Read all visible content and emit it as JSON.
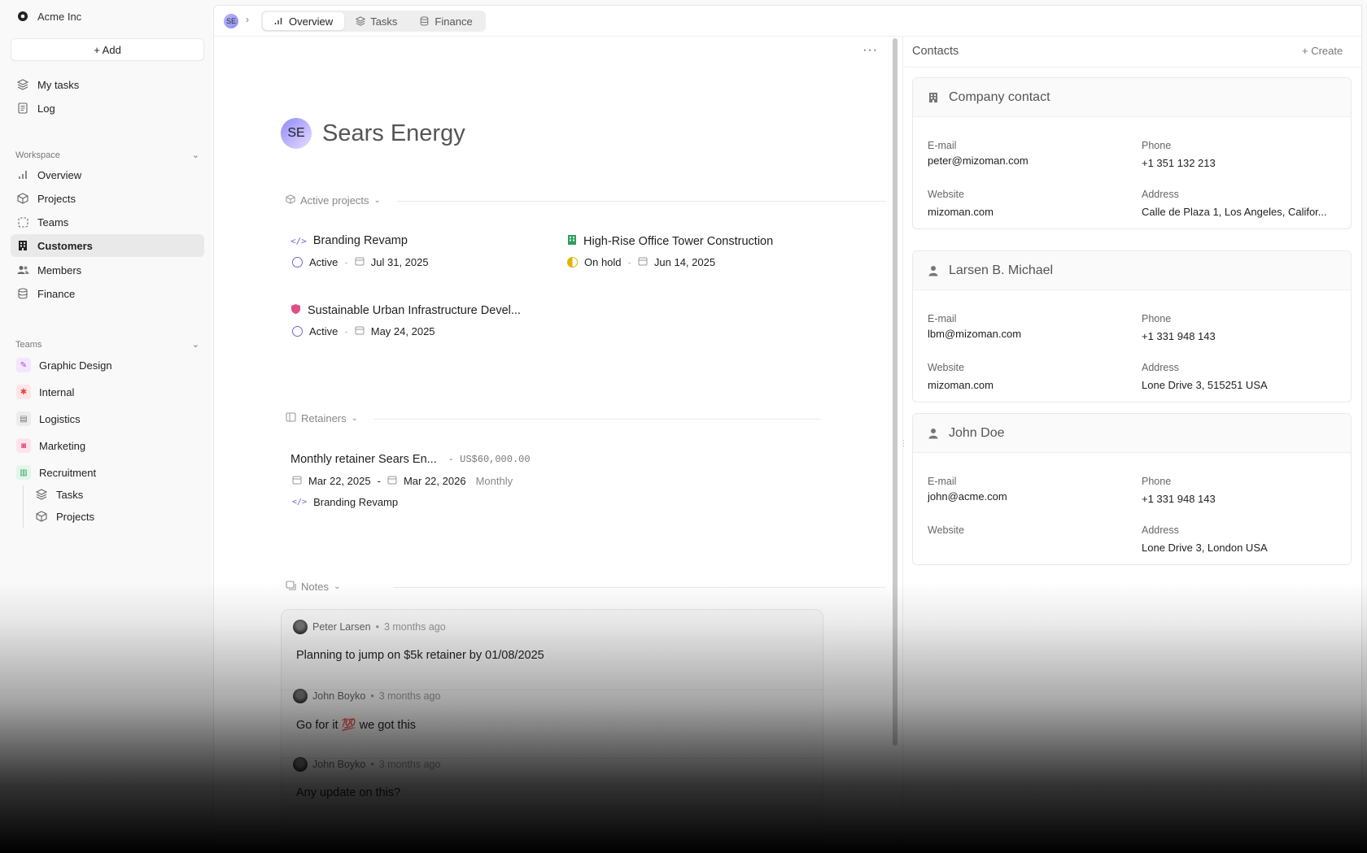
{
  "sidebar": {
    "org_name": "Acme Inc",
    "add_label": "+ Add",
    "top_items": [
      {
        "label": "My tasks",
        "icon": "layers-icon"
      },
      {
        "label": "Log",
        "icon": "log-icon"
      }
    ],
    "workspace_label": "Workspace",
    "workspace_items": [
      {
        "label": "Overview",
        "icon": "bar-chart-icon"
      },
      {
        "label": "Projects",
        "icon": "box-icon"
      },
      {
        "label": "Teams",
        "icon": "dashed-square-icon"
      },
      {
        "label": "Customers",
        "icon": "building-icon"
      },
      {
        "label": "Members",
        "icon": "users-icon"
      },
      {
        "label": "Finance",
        "icon": "database-icon"
      }
    ],
    "teams_label": "Teams",
    "teams": [
      {
        "label": "Graphic Design",
        "color": "#f3e6ff",
        "icon_color": "#a14bd6"
      },
      {
        "label": "Internal",
        "color": "#ffe6e6",
        "icon_color": "#e04545"
      },
      {
        "label": "Logistics",
        "color": "#ececec",
        "icon_color": "#777777"
      },
      {
        "label": "Marketing",
        "color": "#ffe3ec",
        "icon_color": "#e0507a"
      },
      {
        "label": "Recruitment",
        "color": "#e2f6ea",
        "icon_color": "#2f9e5e"
      }
    ],
    "sub_items": [
      {
        "label": "Tasks",
        "icon": "layers-icon"
      },
      {
        "label": "Projects",
        "icon": "box-icon"
      }
    ]
  },
  "topbar": {
    "avatar": "SE",
    "tabs": [
      {
        "label": "Overview",
        "icon": "bar-chart-icon"
      },
      {
        "label": "Tasks",
        "icon": "layers-icon"
      },
      {
        "label": "Finance",
        "icon": "database-icon"
      }
    ]
  },
  "customer": {
    "initials": "SE",
    "name": "Sears Energy"
  },
  "active_projects": {
    "label": "Active projects",
    "items": [
      {
        "name": "Branding Revamp",
        "icon": "code-icon",
        "status": "Active",
        "date": "Jul 31, 2025"
      },
      {
        "name": "High-Rise Office Tower Construction",
        "icon": "building-icon",
        "status": "On hold",
        "date": "Jun 14, 2025"
      },
      {
        "name": "Sustainable Urban Infrastructure Devel...",
        "icon": "shield-icon",
        "status": "Active",
        "date": "May 24, 2025"
      }
    ]
  },
  "retainers": {
    "label": "Retainers",
    "items": [
      {
        "name": "Monthly retainer Sears En...",
        "amount": "- US$60,000.00",
        "start": "Mar 22, 2025",
        "end": "Mar 22, 2026",
        "frequency": "Monthly",
        "project": "Branding Revamp"
      }
    ]
  },
  "notes": {
    "label": "Notes",
    "items": [
      {
        "author": "Peter Larsen",
        "time": "3 months ago",
        "text": "Planning to jump on $5k retainer by 01/08/2025"
      },
      {
        "author": "John Boyko",
        "time": "3 months ago",
        "text": "Go for it 💯 we got this"
      },
      {
        "author": "John Boyko",
        "time": "3 months ago",
        "text": "Any update on this?"
      }
    ]
  },
  "contacts": {
    "title": "Contacts",
    "create_label": "+ Create",
    "field_labels": {
      "email": "E-mail",
      "phone": "Phone",
      "website": "Website",
      "address": "Address"
    },
    "cards": [
      {
        "name": "Company contact",
        "icon": "building-icon",
        "email": "peter@mizoman.com",
        "phone": "+1 351 132 213",
        "website": "mizoman.com",
        "address": "Calle de Plaza 1, Los Angeles, Califor..."
      },
      {
        "name": "Larsen B. Michael",
        "icon": "person-icon",
        "email": "lbm@mizoman.com",
        "phone": "+1 331 948 143",
        "website": "mizoman.com",
        "address": "Lone Drive 3, 515251 USA"
      },
      {
        "name": "John Doe",
        "icon": "person-icon",
        "email": "john@acme.com",
        "phone": "+1 331 948 143",
        "website": "",
        "address": "Lone Drive 3, London USA"
      }
    ]
  }
}
